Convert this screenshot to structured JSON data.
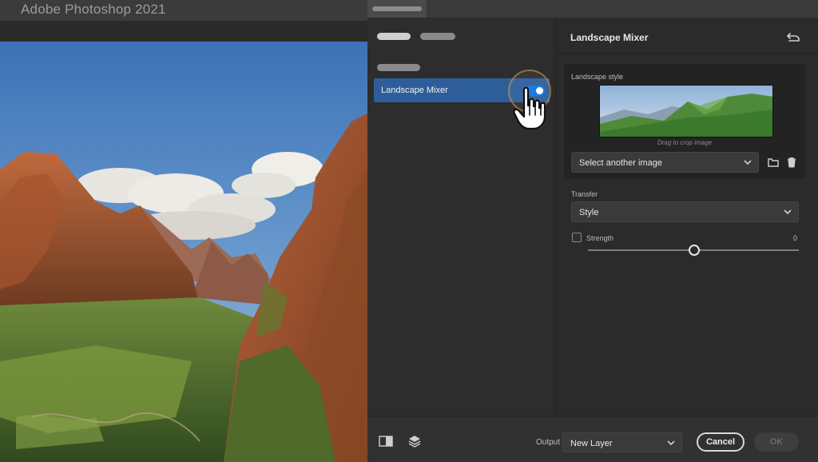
{
  "app": {
    "title": "Adobe Photoshop 2021"
  },
  "panel": {
    "selected_filter": "Landscape Mixer",
    "filter_enabled": true,
    "settings_title": "Landscape Mixer",
    "landscape_style": {
      "label": "Landscape style",
      "caption": "Drag to crop image",
      "select_value": "Select another image"
    },
    "transfer": {
      "label": "Transfer",
      "select_value": "Style"
    },
    "strength": {
      "label": "Strength",
      "value": "0",
      "checked": false
    },
    "footer": {
      "output_label": "Output",
      "output_value": "New Layer",
      "cancel_label": "Cancel",
      "ok_label": "OK"
    }
  },
  "colors": {
    "accent": "#1473e6",
    "selected_row": "#2d5e9a",
    "panel_bg": "#2c2c2c"
  },
  "icons": [
    "reset-icon",
    "folder-icon",
    "trash-icon",
    "chevron-down-icon",
    "compare-icon",
    "layers-icon",
    "hand-pointer-icon"
  ]
}
